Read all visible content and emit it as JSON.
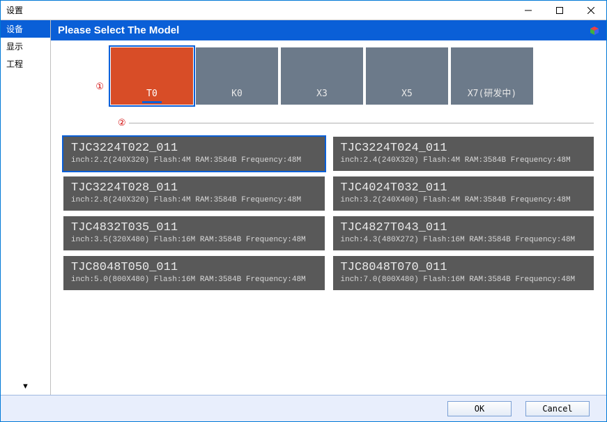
{
  "window": {
    "title": "设置",
    "minimize": "—",
    "maximize": "☐",
    "close": "✕"
  },
  "sidebar": {
    "items": [
      {
        "label": "设备",
        "selected": true
      },
      {
        "label": "显示",
        "selected": false
      },
      {
        "label": "工程",
        "selected": false
      }
    ],
    "arrow": "▼"
  },
  "header": {
    "title": "Please Select The Model"
  },
  "annotations": {
    "one": "①",
    "two": "②"
  },
  "series": [
    {
      "label": "T0",
      "selected": true
    },
    {
      "label": "K0",
      "selected": false
    },
    {
      "label": "X3",
      "selected": false
    },
    {
      "label": "X5",
      "selected": false
    },
    {
      "label": "X7(研发中)",
      "selected": false
    }
  ],
  "models": [
    {
      "name": "TJC3224T022_011",
      "specs": "inch:2.2(240X320) Flash:4M RAM:3584B Frequency:48M",
      "selected": true
    },
    {
      "name": "TJC3224T024_011",
      "specs": "inch:2.4(240X320) Flash:4M RAM:3584B Frequency:48M",
      "selected": false
    },
    {
      "name": "TJC3224T028_011",
      "specs": "inch:2.8(240X320) Flash:4M RAM:3584B Frequency:48M",
      "selected": false
    },
    {
      "name": "TJC4024T032_011",
      "specs": "inch:3.2(240X400) Flash:4M RAM:3584B Frequency:48M",
      "selected": false
    },
    {
      "name": "TJC4832T035_011",
      "specs": "inch:3.5(320X480) Flash:16M RAM:3584B Frequency:48M",
      "selected": false
    },
    {
      "name": "TJC4827T043_011",
      "specs": "inch:4.3(480X272) Flash:16M RAM:3584B Frequency:48M",
      "selected": false
    },
    {
      "name": "TJC8048T050_011",
      "specs": "inch:5.0(800X480) Flash:16M RAM:3584B Frequency:48M",
      "selected": false
    },
    {
      "name": "TJC8048T070_011",
      "specs": "inch:7.0(800X480) Flash:16M RAM:3584B Frequency:48M",
      "selected": false
    }
  ],
  "footer": {
    "ok": "OK",
    "cancel": "Cancel"
  }
}
